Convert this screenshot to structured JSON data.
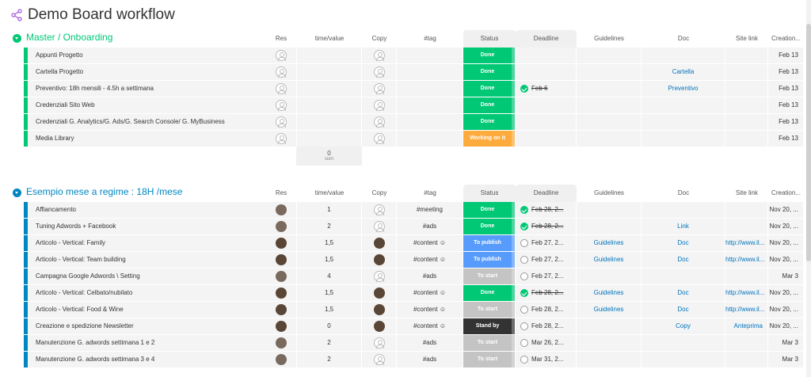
{
  "board": {
    "title": "Demo Board workflow",
    "icon": "share-icon"
  },
  "colors": {
    "done": "#00c875",
    "working": "#fdab3d",
    "to_publish": "#579bfc",
    "to_start": "#c4c4c4",
    "stand_by": "#333333",
    "group1": "#00c875",
    "group2": "#0086c0",
    "link": "#0073bb"
  },
  "columns": [
    "Res",
    "time/value",
    "Copy",
    "#tag",
    "Status",
    "Deadline",
    "Guidelines",
    "Doc",
    "Site link",
    "Creation..."
  ],
  "groups": [
    {
      "title": "Master / Onboarding",
      "rows": [
        {
          "name": "Appunti Progetto",
          "time": "",
          "tag": "",
          "status": "Done",
          "deadline": "",
          "guidelines": "",
          "doc": "",
          "site": "",
          "created": "Feb 13"
        },
        {
          "name": "Cartella Progetto",
          "time": "",
          "tag": "",
          "status": "Done",
          "deadline": "",
          "guidelines": "",
          "doc": "Cartella",
          "site": "",
          "created": "Feb 13"
        },
        {
          "name": "Preventivo: 18h mensili - 4.5h a settimana",
          "time": "",
          "tag": "",
          "status": "Done",
          "deadline": "Feb 6",
          "guidelines": "",
          "doc": "Preventivo",
          "site": "",
          "created": "Feb 13"
        },
        {
          "name": "Credenziali Sito Web",
          "time": "",
          "tag": "",
          "status": "Done",
          "deadline": "",
          "guidelines": "",
          "doc": "",
          "site": "",
          "created": "Feb 13"
        },
        {
          "name": "Credenziali G. Analytics/G. Ads/G. Search Console/ G. MyBusiness",
          "time": "",
          "tag": "",
          "status": "Done",
          "deadline": "",
          "guidelines": "",
          "doc": "",
          "site": "",
          "created": "Feb 13"
        },
        {
          "name": "Media Library",
          "time": "",
          "tag": "",
          "status": "Working on it",
          "deadline": "",
          "guidelines": "",
          "doc": "",
          "site": "",
          "created": "Feb 13"
        }
      ],
      "sum": {
        "value": "0",
        "label": "sum"
      }
    },
    {
      "title": "Esempio mese a regime : 18H /mese",
      "rows": [
        {
          "name": "Affiancamento",
          "time": "1",
          "tag": "#meeting",
          "status": "Done",
          "deadline": "Feb 28, 2...",
          "guidelines": "",
          "doc": "",
          "site": "",
          "created": "Nov 20, ..."
        },
        {
          "name": "Tuning Adwords + Facebook",
          "time": "2",
          "tag": "#ads",
          "status": "Done",
          "deadline": "Feb 28, 2...",
          "guidelines": "",
          "doc": "Link",
          "site": "",
          "created": "Nov 20, ..."
        },
        {
          "name": "Articolo - Vertical: Family",
          "time": "1,5",
          "tag": "#content ☺",
          "status": "To publish",
          "deadline": "Feb 27, 2...",
          "guidelines": "Guidelines",
          "doc": "Doc",
          "site": "http://www.il...",
          "created": "Nov 20, ..."
        },
        {
          "name": "Articolo - Vertical: Team building",
          "time": "1,5",
          "tag": "#content ☺",
          "status": "To publish",
          "deadline": "Feb 27, 2...",
          "guidelines": "Guidelines",
          "doc": "Doc",
          "site": "http://www.il...",
          "created": "Nov 20, ..."
        },
        {
          "name": "Campagna Google Adwords \\ Setting",
          "time": "4",
          "tag": "#ads",
          "status": "To start",
          "deadline": "Feb 27, 2...",
          "guidelines": "",
          "doc": "",
          "site": "",
          "created": "Mar 3"
        },
        {
          "name": "Articolo - Vertical: Celbato/nubilato",
          "time": "1,5",
          "tag": "#content ☺",
          "status": "Done",
          "deadline": "Feb 28, 2...",
          "guidelines": "Guidelines",
          "doc": "Doc",
          "site": "http://www.il...",
          "created": "Nov 20, ..."
        },
        {
          "name": "Articolo - Vertical: Food & Wine",
          "time": "1,5",
          "tag": "#content ☺",
          "status": "To start",
          "deadline": "Feb 28, 2...",
          "guidelines": "Guidelines",
          "doc": "Doc",
          "site": "http://www.il...",
          "created": "Nov 20, ..."
        },
        {
          "name": "Creazione e spedizione Newsletter",
          "time": "0",
          "tag": "#content ☺",
          "status": "Stand by",
          "deadline": "Feb 28, 2...",
          "guidelines": "",
          "doc": "Copy",
          "site": "Anteprima",
          "created": "Nov 20, ..."
        },
        {
          "name": "Manutenzione G. adwords settimana 1 e 2",
          "time": "2",
          "tag": "#ads",
          "status": "To start",
          "deadline": "Mar 26, 2...",
          "guidelines": "",
          "doc": "",
          "site": "",
          "created": "Mar 3"
        },
        {
          "name": "Manutenzione G. adwords settimana 3 e 4",
          "time": "2",
          "tag": "#ads",
          "status": "To start",
          "deadline": "Mar 31, 2...",
          "guidelines": "",
          "doc": "",
          "site": "",
          "created": "Mar 3"
        }
      ]
    }
  ]
}
